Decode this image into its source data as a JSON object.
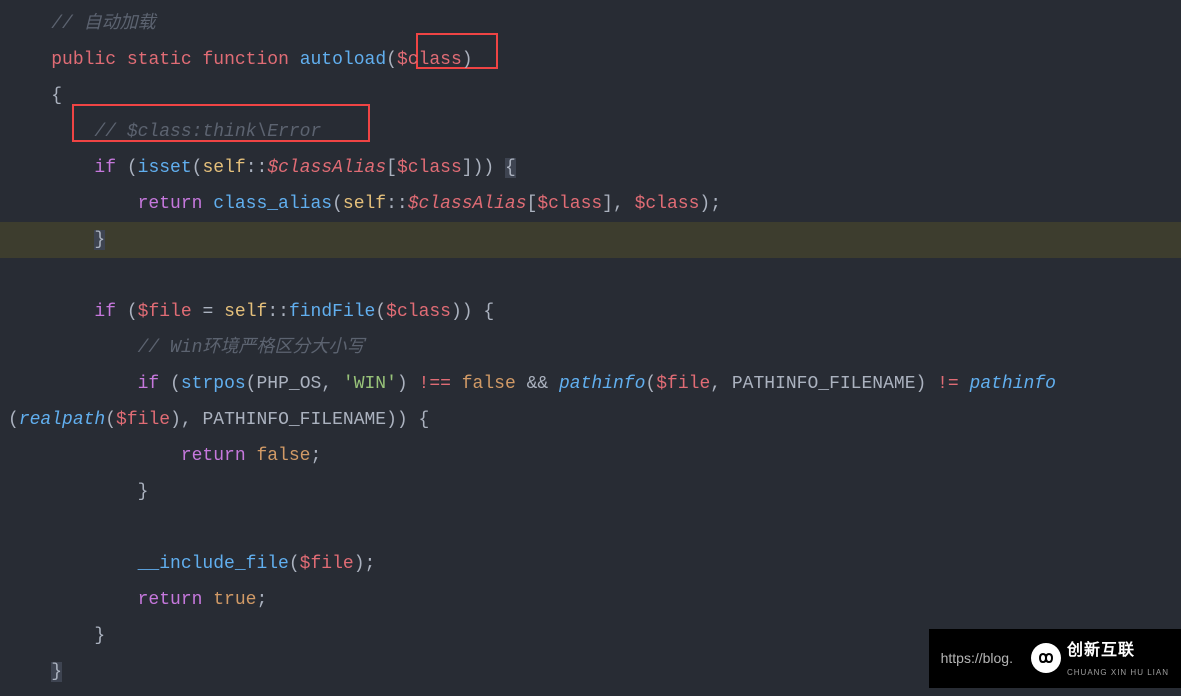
{
  "code": {
    "line1_comment": "// 自动加载",
    "line2": {
      "public": "public",
      "static": "static",
      "function": "function",
      "autoload": "autoload",
      "class_param": "$class"
    },
    "line3_brace": "{",
    "line4_comment": "// $class:think\\Error",
    "line5": {
      "if": "if",
      "isset": "isset",
      "self": "self",
      "classAlias": "$classAlias",
      "class_var": "$class"
    },
    "line6": {
      "return": "return",
      "class_alias": "class_alias",
      "self": "self",
      "classAlias": "$classAlias",
      "class_var": "$class"
    },
    "line7_brace": "}",
    "line9": {
      "if": "if",
      "file": "$file",
      "self": "self",
      "findFile": "findFile",
      "class_var": "$class"
    },
    "line10_comment": "// Win环境严格区分大小写",
    "line11": {
      "if": "if",
      "strpos": "strpos",
      "php_os": "PHP_OS",
      "win": "'WIN'",
      "not_equals": "!==",
      "false": "false",
      "and": "&&",
      "pathinfo": "pathinfo",
      "file": "$file",
      "pathinfo_filename": "PATHINFO_FILENAME",
      "not_eq2": "!=",
      "pathinfo2": "pathinfo"
    },
    "line12": {
      "realpath": "realpath",
      "file": "$file",
      "pathinfo_filename": "PATHINFO_FILENAME"
    },
    "line13": {
      "return": "return",
      "false": "false"
    },
    "line14_brace": "}",
    "line16": {
      "include_file": "__include_file",
      "file": "$file"
    },
    "line17": {
      "return": "return",
      "true": "true"
    },
    "line18_brace": "}",
    "line19_brace": "}"
  },
  "watermark": {
    "url": "https://blog.",
    "brand": "创新互联",
    "brand_sub": "CHUANG XIN HU LIAN"
  }
}
